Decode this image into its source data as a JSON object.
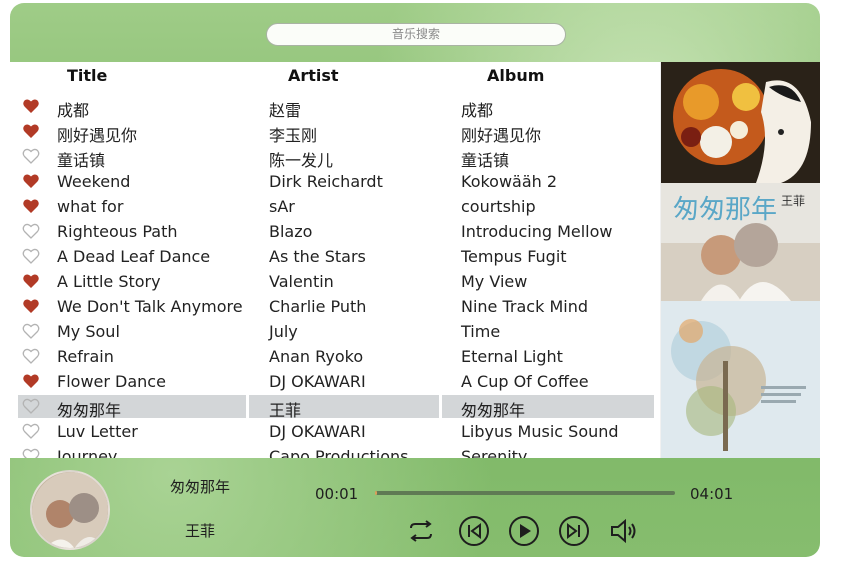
{
  "search": {
    "placeholder": "音乐搜索"
  },
  "columns": {
    "title": "Title",
    "artist": "Artist",
    "album": "Album"
  },
  "songs": [
    {
      "liked": true,
      "title": "成都",
      "artist": "赵雷",
      "album": "成都"
    },
    {
      "liked": true,
      "title": "刚好遇见你",
      "artist": "李玉刚",
      "album": "刚好遇见你"
    },
    {
      "liked": false,
      "title": "童话镇",
      "artist": "陈一发儿",
      "album": "童话镇"
    },
    {
      "liked": true,
      "title": "Weekend",
      "artist": "Dirk Reichardt",
      "album": "Kokowääh 2"
    },
    {
      "liked": true,
      "title": "what for",
      "artist": "sAr",
      "album": "courtship"
    },
    {
      "liked": false,
      "title": "Righteous Path",
      "artist": "Blazo",
      "album": "Introducing Mellow"
    },
    {
      "liked": false,
      "title": "A Dead Leaf Dance",
      "artist": "As the Stars",
      "album": "Tempus Fugit"
    },
    {
      "liked": true,
      "title": "A Little Story",
      "artist": "Valentin",
      "album": "My View"
    },
    {
      "liked": true,
      "title": "We Don't Talk Anymore",
      "artist": "Charlie Puth",
      "album": "Nine Track Mind"
    },
    {
      "liked": false,
      "title": "My Soul",
      "artist": "July",
      "album": "Time"
    },
    {
      "liked": false,
      "title": "Refrain",
      "artist": "Anan Ryoko",
      "album": "Eternal Light"
    },
    {
      "liked": true,
      "title": "Flower Dance",
      "artist": "DJ OKAWARI",
      "album": "A Cup Of Coffee"
    },
    {
      "liked": false,
      "title": "匆匆那年",
      "artist": "王菲",
      "album": "匆匆那年",
      "selected": true
    },
    {
      "liked": false,
      "title": "Luv Letter",
      "artist": "DJ OKAWARI",
      "album": "Libyus Music Sound"
    },
    {
      "liked": false,
      "title": "Journey",
      "artist": "Capo Productions",
      "album": "Serenity"
    }
  ],
  "covers": [
    {
      "name": "illustrated-album-cover"
    },
    {
      "name": "album-cover-匆匆那年",
      "text_main": "匆匆那年",
      "text_side": "王菲"
    },
    {
      "name": "libyus-album-cover"
    }
  ],
  "player": {
    "now_title": "匆匆那年",
    "now_artist": "王菲",
    "current_time": "00:01",
    "total_time": "04:01",
    "progress": 0.004,
    "icons": [
      "repeat-icon",
      "previous-icon",
      "play-icon",
      "next-icon",
      "volume-icon"
    ]
  },
  "colors": {
    "heart": "#b23a26",
    "heart_outline": "#b3b3b3",
    "selected_row": "#d3d6d8"
  }
}
